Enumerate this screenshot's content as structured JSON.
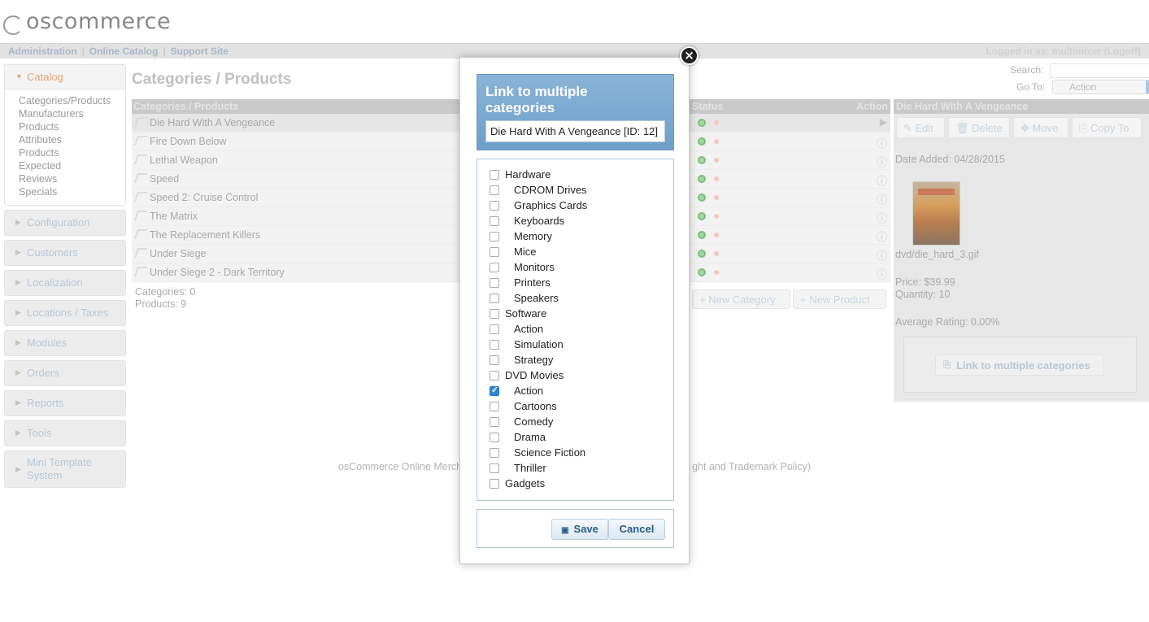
{
  "app": {
    "logo_text": "oscommerce"
  },
  "topbar": {
    "links": [
      "Administration",
      "Online Catalog",
      "Support Site"
    ],
    "separator": "|",
    "logged_in": "Logged in as: multimixer (Logoff)"
  },
  "sidebar": {
    "active": {
      "label": "Catalog",
      "items": [
        "Categories/Products",
        "Manufacturers",
        "Products",
        "Attributes",
        "Products",
        "Expected",
        "Reviews",
        "Specials"
      ]
    },
    "sections": [
      "Configuration",
      "Customers",
      "Localization",
      "Locations / Taxes",
      "Modules",
      "Orders",
      "Reports",
      "Tools"
    ],
    "last_section": {
      "line1": "Mini Template",
      "line2": "System"
    }
  },
  "main": {
    "title": "Categories / Products",
    "search_label": "Search:",
    "goto_label": "Go To:",
    "goto_value": "Action",
    "columns": {
      "name": "Categories / Products",
      "status": "Status",
      "action": "Action"
    },
    "rows": [
      "Die Hard With A Vengeance",
      "Fire Down Below",
      "Lethal Weapon",
      "Speed",
      "Speed 2: Cruise Control",
      "The Matrix",
      "The Replacement Killers",
      "Under Siege",
      "Under Siege 2 - Dark Territory"
    ],
    "categories_count": "Categories: 0",
    "products_count": "Products: 9",
    "new_category": "New Category",
    "new_product": "New Product"
  },
  "info": {
    "title": "Die Hard With A Vengeance",
    "edit": "Edit",
    "delete": "Delete",
    "move": "Move",
    "copy_to": "Copy To",
    "date_added": "Date Added: 04/28/2015",
    "image_file": "dvd/die_hard_3.gif",
    "price": "Price: $39.99",
    "quantity": "Quantity: 10",
    "rating": "Average Rating: 0.00%",
    "link_button": "Link to multiple categories"
  },
  "footer": {
    "left": "osCommerce Online Merch",
    "right": "ght and Trademark Policy)"
  },
  "modal": {
    "close_glyph": "×",
    "title_line1": "Link to multiple",
    "title_line2": "categories",
    "product_name": "Die Hard With A Vengeance [ID: 12]",
    "categories": [
      {
        "label": "Hardware",
        "level": 0,
        "checked": false
      },
      {
        "label": "CDROM Drives",
        "level": 1,
        "checked": false
      },
      {
        "label": "Graphics Cards",
        "level": 1,
        "checked": false
      },
      {
        "label": "Keyboards",
        "level": 1,
        "checked": false
      },
      {
        "label": "Memory",
        "level": 1,
        "checked": false
      },
      {
        "label": "Mice",
        "level": 1,
        "checked": false
      },
      {
        "label": "Monitors",
        "level": 1,
        "checked": false
      },
      {
        "label": "Printers",
        "level": 1,
        "checked": false
      },
      {
        "label": "Speakers",
        "level": 1,
        "checked": false
      },
      {
        "label": "Software",
        "level": 0,
        "checked": false
      },
      {
        "label": "Action",
        "level": 1,
        "checked": false
      },
      {
        "label": "Simulation",
        "level": 1,
        "checked": false
      },
      {
        "label": "Strategy",
        "level": 1,
        "checked": false
      },
      {
        "label": "DVD Movies",
        "level": 0,
        "checked": false
      },
      {
        "label": "Action",
        "level": 1,
        "checked": true
      },
      {
        "label": "Cartoons",
        "level": 1,
        "checked": false
      },
      {
        "label": "Comedy",
        "level": 1,
        "checked": false
      },
      {
        "label": "Drama",
        "level": 1,
        "checked": false
      },
      {
        "label": "Science Fiction",
        "level": 1,
        "checked": false
      },
      {
        "label": "Thriller",
        "level": 1,
        "checked": false
      },
      {
        "label": "Gadgets",
        "level": 0,
        "checked": false
      }
    ],
    "save": "Save",
    "cancel": "Cancel"
  },
  "colors": {
    "modal_header": "#7aa9d1",
    "checkbox_checked": "#2f86d6",
    "button_text": "#2b5d8a"
  }
}
